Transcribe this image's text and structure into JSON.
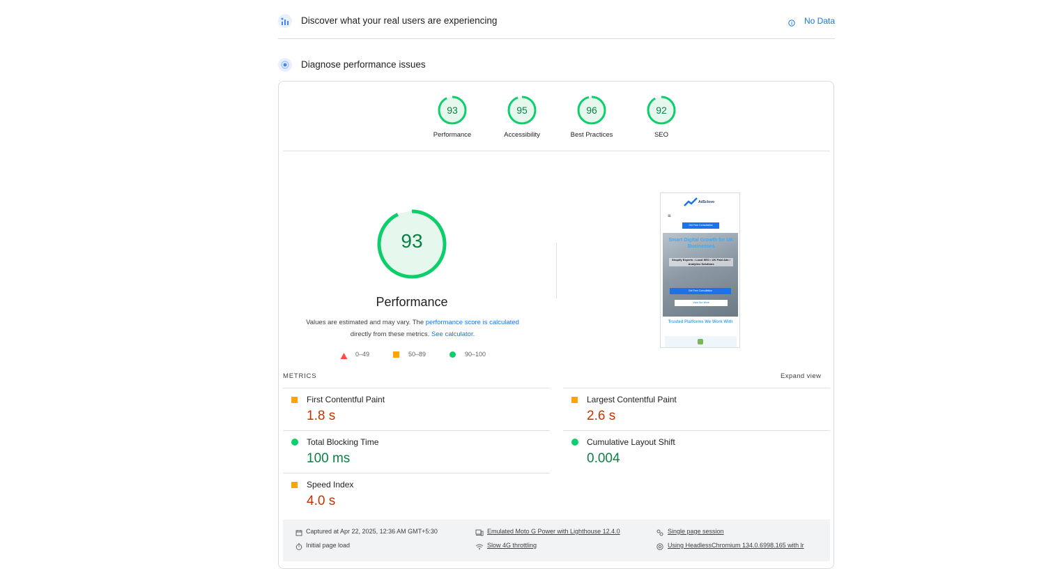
{
  "field_section": {
    "title": "Discover what your real users are experiencing",
    "status": "No Data"
  },
  "lab_section": {
    "title": "Diagnose performance issues"
  },
  "scores": [
    {
      "label": "Performance",
      "value": "93"
    },
    {
      "label": "Accessibility",
      "value": "95"
    },
    {
      "label": "Best Practices",
      "value": "96"
    },
    {
      "label": "SEO",
      "value": "92"
    }
  ],
  "main_score": {
    "value": "93",
    "label": "Performance",
    "desc_part1": "Values are estimated and may vary. The ",
    "desc_link1": "performance score is calculated",
    "desc_part2": "directly from these metrics. ",
    "desc_link2": "See calculator."
  },
  "legend": {
    "poor": "0–49",
    "average": "50–89",
    "good": "90–100"
  },
  "colors": {
    "good": "#0cce6b",
    "average": "#ffa400",
    "poor": "#ff4e42",
    "link": "#1a73e8"
  },
  "screenshot": {
    "brand": "AdSclovo",
    "cta": "Get Free Consultation",
    "headline": "Smart Digital Growth for UK Businesses",
    "sub": "Shopify Experts • Local SEO • UK Paid Ads • Analytics Solutions",
    "btn1": "Get Free Consultation",
    "btn2": "View Our Work",
    "trusted": "Trusted Platforms We Work With"
  },
  "metrics_header": {
    "label": "METRICS",
    "expand": "Expand view"
  },
  "metrics": [
    {
      "name": "First Contentful Paint",
      "value": "1.8 s",
      "rating": "average"
    },
    {
      "name": "Largest Contentful Paint",
      "value": "2.6 s",
      "rating": "average"
    },
    {
      "name": "Total Blocking Time",
      "value": "100 ms",
      "rating": "good"
    },
    {
      "name": "Cumulative Layout Shift",
      "value": "0.004",
      "rating": "good"
    },
    {
      "name": "Speed Index",
      "value": "4.0 s",
      "rating": "average"
    }
  ],
  "footer": {
    "captured": "Captured at Apr 22, 2025, 12:36 AM GMT+5:30",
    "device": "Emulated Moto G Power with Lighthouse 12.4.0",
    "session": "Single page session",
    "load": "Initial page load",
    "throttling": "Slow 4G throttling",
    "browser": "Using HeadlessChromium 134.0.6998.165 with lr"
  }
}
